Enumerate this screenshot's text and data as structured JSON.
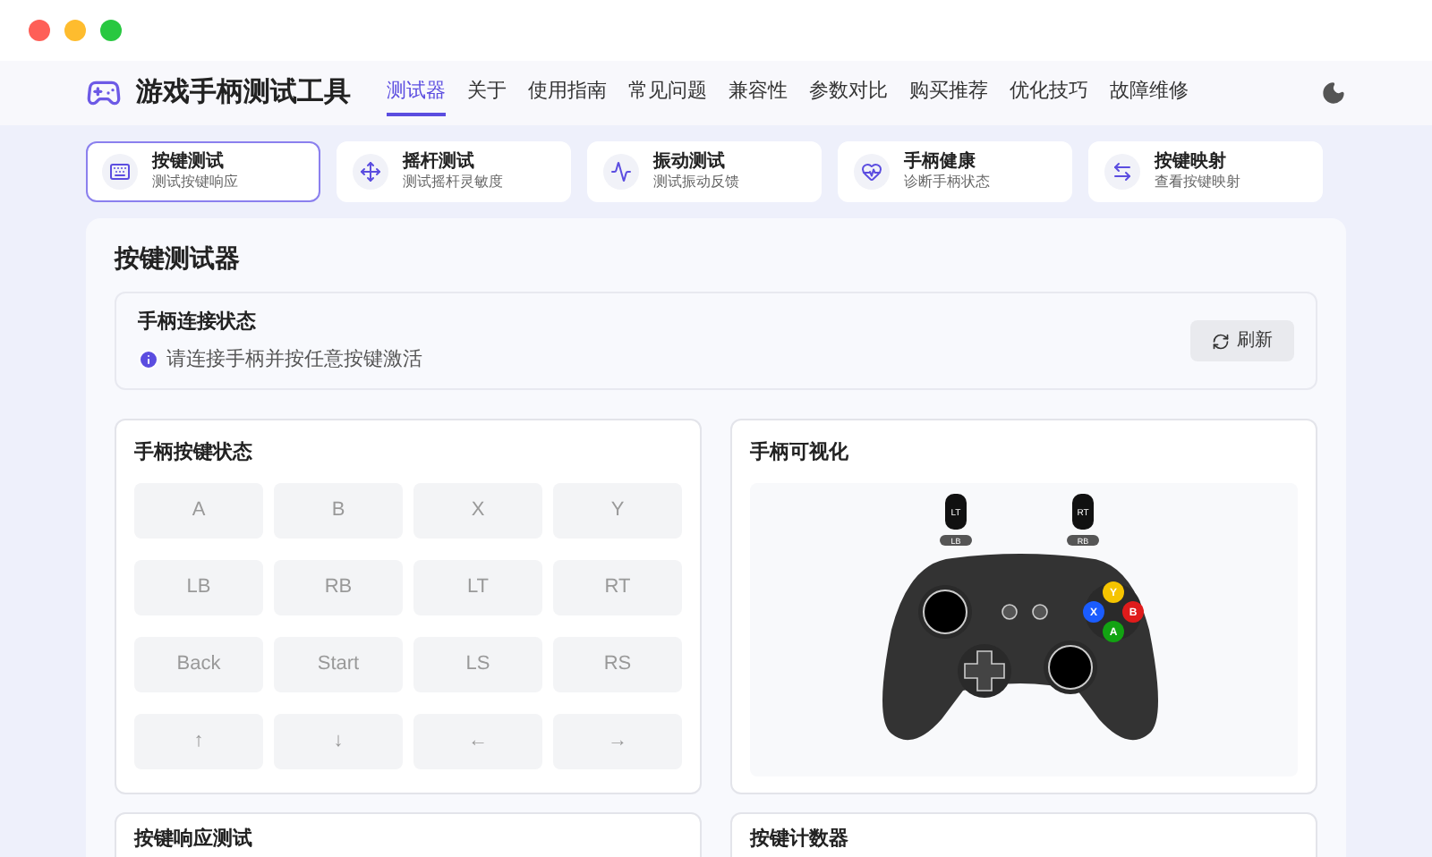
{
  "app": {
    "title": "游戏手柄测试工具"
  },
  "nav": [
    {
      "label": "测试器",
      "selected": true
    },
    {
      "label": "关于",
      "selected": false
    },
    {
      "label": "使用指南",
      "selected": false
    },
    {
      "label": "常见问题",
      "selected": false
    },
    {
      "label": "兼容性",
      "selected": false
    },
    {
      "label": "参数对比",
      "selected": false
    },
    {
      "label": "购买推荐",
      "selected": false
    },
    {
      "label": "优化技巧",
      "selected": false
    },
    {
      "label": "故障维修",
      "selected": false
    }
  ],
  "tools": [
    {
      "kind": "keyboard",
      "title": "按键测试",
      "subtitle": "测试按键响应",
      "selected": true
    },
    {
      "kind": "move",
      "title": "摇杆测试",
      "subtitle": "测试摇杆灵敏度",
      "selected": false
    },
    {
      "kind": "pulse",
      "title": "振动测试",
      "subtitle": "测试振动反馈",
      "selected": false
    },
    {
      "kind": "heart",
      "title": "手柄健康",
      "subtitle": "诊断手柄状态",
      "selected": false
    },
    {
      "kind": "swap",
      "title": "按键映射",
      "subtitle": "查看按键映射",
      "selected": false
    }
  ],
  "panel": {
    "title": "按键测试器"
  },
  "connection": {
    "title": "手柄连接状态",
    "message": "请连接手柄并按任意按键激活",
    "refresh": "刷新"
  },
  "buttons_panel": {
    "title": "手柄按键状态",
    "buttons": [
      {
        "label": "A",
        "pressed": false
      },
      {
        "label": "B",
        "pressed": false
      },
      {
        "label": "X",
        "pressed": false
      },
      {
        "label": "Y",
        "pressed": false
      },
      {
        "label": "LB",
        "pressed": false
      },
      {
        "label": "RB",
        "pressed": false
      },
      {
        "label": "LT",
        "pressed": false
      },
      {
        "label": "RT",
        "pressed": false
      },
      {
        "label": "Back",
        "pressed": false
      },
      {
        "label": "Start",
        "pressed": false
      },
      {
        "label": "LS",
        "pressed": false
      },
      {
        "label": "RS",
        "pressed": false
      },
      {
        "label": "↑",
        "pressed": false
      },
      {
        "label": "↓",
        "pressed": false
      },
      {
        "label": "←",
        "pressed": false
      },
      {
        "label": "→",
        "pressed": false
      }
    ]
  },
  "visual_panel": {
    "title": "手柄可视化",
    "triggers": [
      "LT",
      "RT"
    ],
    "bumpers": [
      "LB",
      "RB"
    ],
    "face_buttons": [
      {
        "label": "Y",
        "color": "#f5c400"
      },
      {
        "label": "X",
        "color": "#1a5cff"
      },
      {
        "label": "B",
        "color": "#e01b1b"
      },
      {
        "label": "A",
        "color": "#12a312"
      }
    ]
  },
  "bottom_panels": [
    {
      "title": "按键响应测试"
    },
    {
      "title": "按键计数器"
    }
  ]
}
